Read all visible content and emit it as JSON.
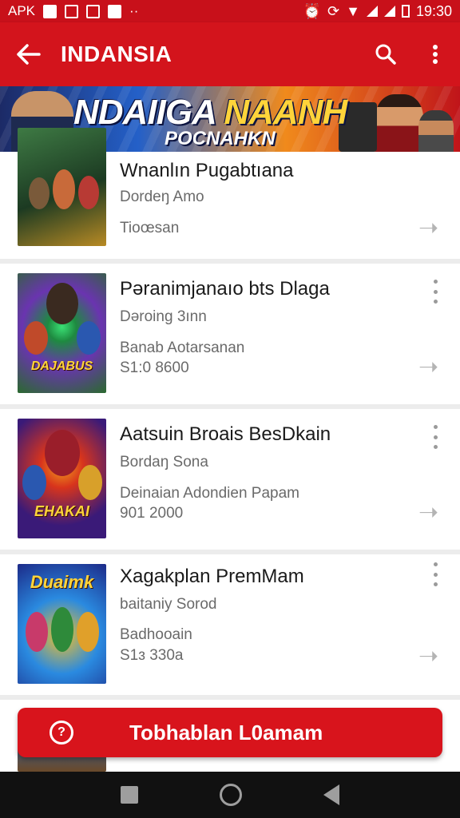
{
  "status_bar": {
    "left_label": "APK",
    "time": "19:30",
    "icons": [
      "image-icon",
      "doc-icon",
      "mail-icon",
      "photo-icon",
      "dots-icon",
      "alarm-icon",
      "sync-icon",
      "wifi-icon",
      "signal-icon",
      "signal-icon",
      "battery-icon"
    ]
  },
  "app_bar": {
    "title": "INDANSIA",
    "icons": [
      "back-arrow-icon",
      "search-icon",
      "more-vert-icon"
    ],
    "color": "#d3141c"
  },
  "banner": {
    "headline_part1": "NDAIIGA ",
    "headline_part2": "NAANH",
    "subline": "POCNAHKN"
  },
  "items": [
    {
      "title": "Wnanlın Pugabtıana",
      "subtitle": "Dordeŋ Amo",
      "detail": "Tioœsan",
      "price": "",
      "thumb_colors": [
        "#2a5a34",
        "#c8a42a"
      ]
    },
    {
      "title": "Pəranimjanaıo bts Dlaga",
      "subtitle": "Dəroing 3ınn",
      "detail": "Banab Aotarsanan",
      "price": "S1:0 8600",
      "thumb_colors": [
        "#6a34b0",
        "#2e8a3a"
      ]
    },
    {
      "title": "Aatsuin Broais BesDkain",
      "subtitle": "Bordaŋ Sona",
      "detail": "Deinaian Adondien Papam",
      "price": "901 2000",
      "thumb_colors": [
        "#3a1a78",
        "#d8341c"
      ]
    },
    {
      "title": "Xagakplan PremMam",
      "subtitle": "baitaniy Sorod",
      "detail": "Badhooain",
      "price": "S1ɜ 330a",
      "thumb_colors": [
        "#1c4ab0",
        "#f0a21c"
      ]
    }
  ],
  "thumb_logos": [
    "",
    "DAJABUS",
    "EHAKAI",
    "Duaimk"
  ],
  "cta": {
    "label": "Tobhablan L0amam",
    "icon": "refresh-icon"
  },
  "nav_bar": {
    "icons": [
      "recents-icon",
      "home-icon",
      "back-icon"
    ]
  }
}
